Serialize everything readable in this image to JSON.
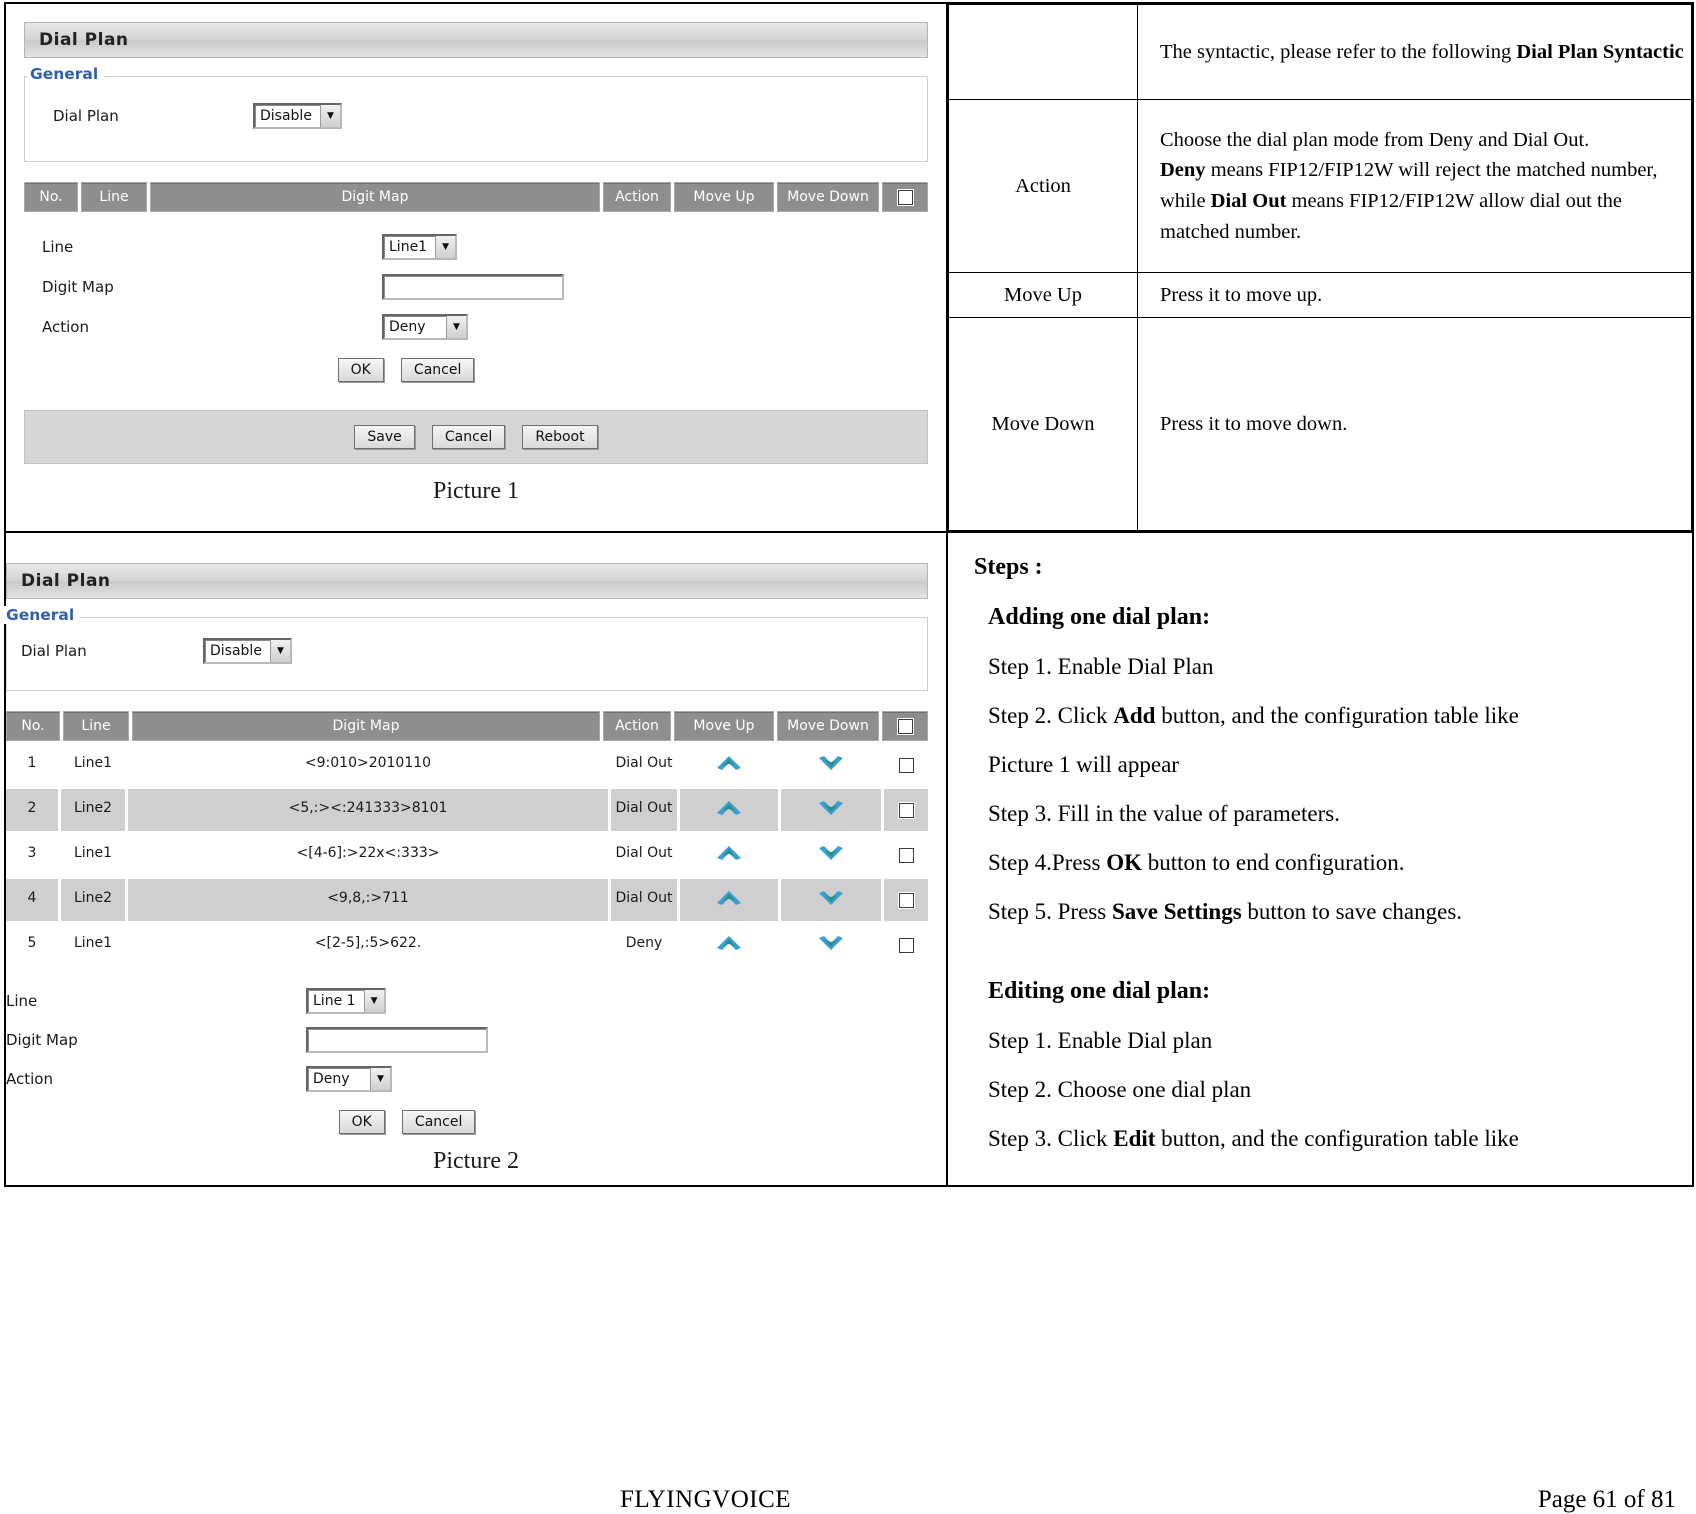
{
  "spec_table": {
    "rows": [
      {
        "name": "",
        "desc_html": "The syntactic, please refer to the following <b>Dial Plan Syntactic</b>",
        "desc_text": "The syntactic, please refer to the following Dial Plan Syntactic"
      },
      {
        "name": "Action",
        "desc_html": "Choose the dial plan mode from Deny and Dial Out.<br><b>Deny</b> means FIP12/FIP12W will reject the matched number, while <b>Dial Out</b> means FIP12/FIP12W allow dial out the matched number.",
        "desc_text": "Choose the dial plan mode from Deny and Dial Out. Deny means FIP12/FIP12W will reject the matched number, while Dial Out means FIP12/FIP12W allow dial out the matched number."
      },
      {
        "name": "Move Up",
        "desc_html": "Press it to move up.",
        "desc_text": "Press it to move up."
      },
      {
        "name": "Move Down",
        "desc_html": "Press it to move down.",
        "desc_text": "Press it to move down."
      }
    ]
  },
  "steps": {
    "title": "Steps :",
    "adding_heading": "Adding one dial plan:",
    "adding_steps_html": [
      "Step 1. Enable Dial Plan",
      "Step 2. Click <b>Add</b> button, and the configuration table like",
      "Picture 1 will appear",
      "Step 3. Fill in the value of parameters.",
      "Step 4.Press <b>OK</b> button to end configuration.",
      "Step 5. Press <b>Save Settings</b> button to save changes."
    ],
    "editing_heading": "Editing one dial plan:",
    "editing_steps_html": [
      "Step 1. Enable Dial plan",
      "Step 2. Choose one dial plan",
      "Step 3. Click <b>Edit</b> button, and the configuration table like"
    ]
  },
  "picture1": {
    "caption": "Picture 1",
    "panel_title": "Dial Plan",
    "legend": "General",
    "dial_plan_label": "Dial Plan",
    "dial_plan_value": "Disable",
    "grid_headers": [
      "No.",
      "Line",
      "Digit Map",
      "Action",
      "Move Up",
      "Move Down"
    ],
    "form": {
      "line_label": "Line",
      "line_value": "Line1",
      "digit_map_label": "Digit Map",
      "digit_map_value": "",
      "action_label": "Action",
      "action_value": "Deny",
      "ok_label": "OK",
      "cancel_label": "Cancel"
    },
    "save_bar": {
      "save_label": "Save",
      "cancel_label": "Cancel",
      "reboot_label": "Reboot"
    }
  },
  "picture2": {
    "caption": "Picture 2",
    "panel_title": "Dial Plan",
    "legend": "General",
    "dial_plan_label": "Dial Plan",
    "dial_plan_value": "Disable",
    "grid_headers": [
      "No.",
      "Line",
      "Digit Map",
      "Action",
      "Move Up",
      "Move Down"
    ],
    "grid_rows": [
      {
        "no": "1",
        "line": "Line1",
        "digit_map": "<9:010>2010110",
        "action": "Dial Out"
      },
      {
        "no": "2",
        "line": "Line2",
        "digit_map": "<5,:><:241333>8101",
        "action": "Dial Out"
      },
      {
        "no": "3",
        "line": "Line1",
        "digit_map": "<[4-6]:>22x<:333>",
        "action": "Dial Out"
      },
      {
        "no": "4",
        "line": "Line2",
        "digit_map": "<9,8,:>711",
        "action": "Dial Out"
      },
      {
        "no": "5",
        "line": "Line1",
        "digit_map": "<[2-5],:5>622.",
        "action": "Deny"
      }
    ],
    "form": {
      "line_label": "Line",
      "line_value": "Line 1",
      "digit_map_label": "Digit Map",
      "digit_map_value": "",
      "action_label": "Action",
      "action_value": "Deny",
      "ok_label": "OK",
      "cancel_label": "Cancel"
    }
  },
  "footer": {
    "brand": "FLYINGVOICE",
    "page": "Page  61  of  81"
  },
  "colors": {
    "legend_blue": "#2f5fae",
    "grid_header_gray": "#8e8e8e",
    "row_alt_gray": "#cfcfcf",
    "chevron_blue": "#2f9fd0",
    "chevron_teal": "#2e8f86"
  }
}
